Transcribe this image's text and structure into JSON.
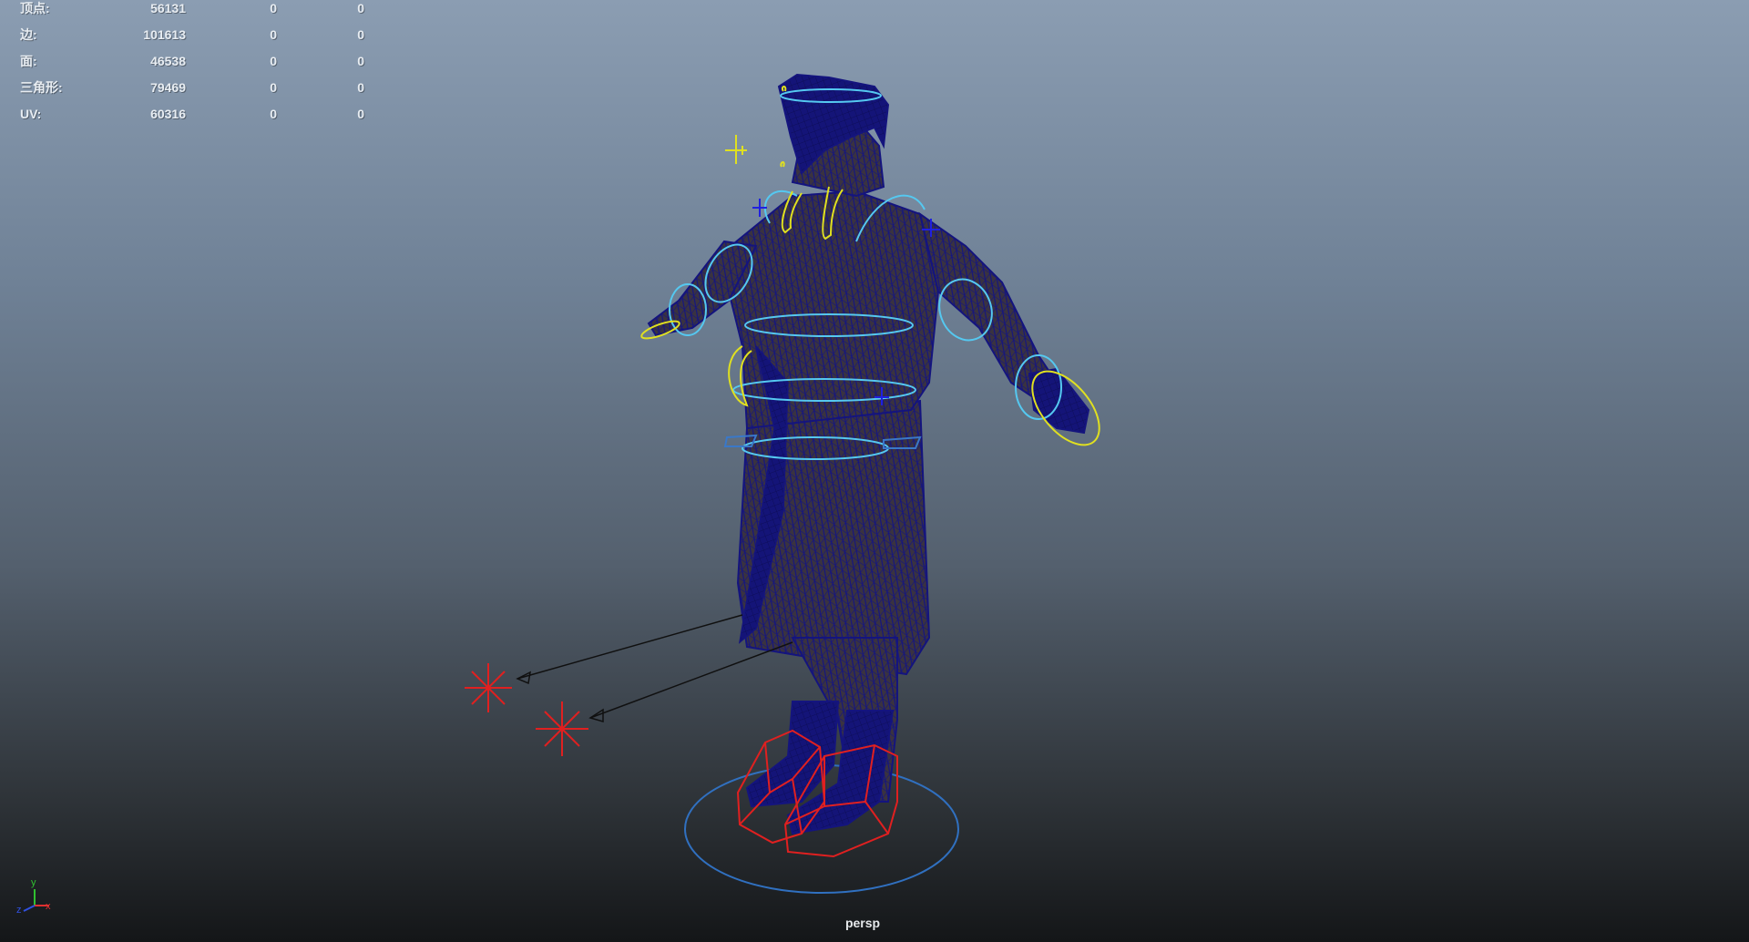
{
  "viewport": {
    "camera_name": "persp",
    "background_top": "#8b9db2",
    "background_bottom": "#141618"
  },
  "hud": {
    "rows": [
      {
        "label": "顶点:",
        "v0": "56131",
        "v1": "0",
        "v2": "0"
      },
      {
        "label": "边:",
        "v0": "101613",
        "v1": "0",
        "v2": "0"
      },
      {
        "label": "面:",
        "v0": "46538",
        "v1": "0",
        "v2": "0"
      },
      {
        "label": "三角形:",
        "v0": "79469",
        "v1": "0",
        "v2": "0"
      },
      {
        "label": "UV:",
        "v0": "60316",
        "v1": "0",
        "v2": "0"
      }
    ]
  },
  "axis_gizmo": {
    "x": "x",
    "y": "y",
    "z": "z"
  },
  "colors": {
    "mesh_wire": "#14147e",
    "fk_controls": "#55c8f0",
    "ik_controls": "#e0e020",
    "foot_controls": "#e02020",
    "root_control": "#3070c0",
    "joint_blue": "#2020e0"
  }
}
